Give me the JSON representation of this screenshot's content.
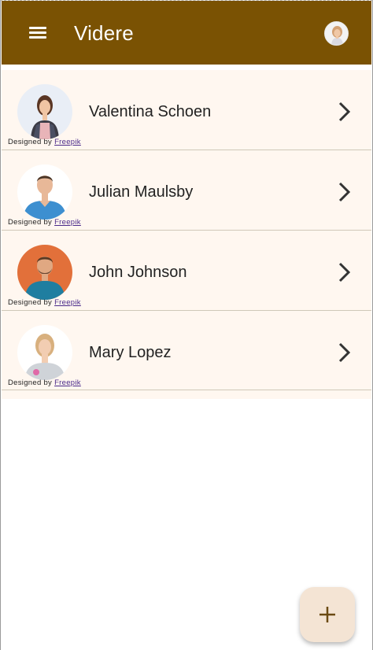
{
  "app": {
    "title": "Videre",
    "colors": {
      "appbar": "#7a5203",
      "list_bg": "#fff7f0",
      "fab_bg": "#f4e4d4"
    }
  },
  "header": {
    "menu_icon": "menu-icon",
    "account_icon": "account-avatar"
  },
  "contacts": [
    {
      "name": "Valentina Schoen",
      "credit_prefix": "Designed by",
      "credit_link": "Freepik",
      "avatar_bg": "#e9eef6"
    },
    {
      "name": "Julian Maulsby",
      "credit_prefix": "Designed by",
      "credit_link": "Freepik",
      "avatar_bg": "#ffffff"
    },
    {
      "name": "John Johnson",
      "credit_prefix": "Designed by",
      "credit_link": "Freepik",
      "avatar_bg": "#e2703a"
    },
    {
      "name": "Mary Lopez",
      "credit_prefix": "Designed by",
      "credit_link": "Freepik",
      "avatar_bg": "#ffffff"
    }
  ],
  "fab": {
    "icon": "add-icon"
  }
}
